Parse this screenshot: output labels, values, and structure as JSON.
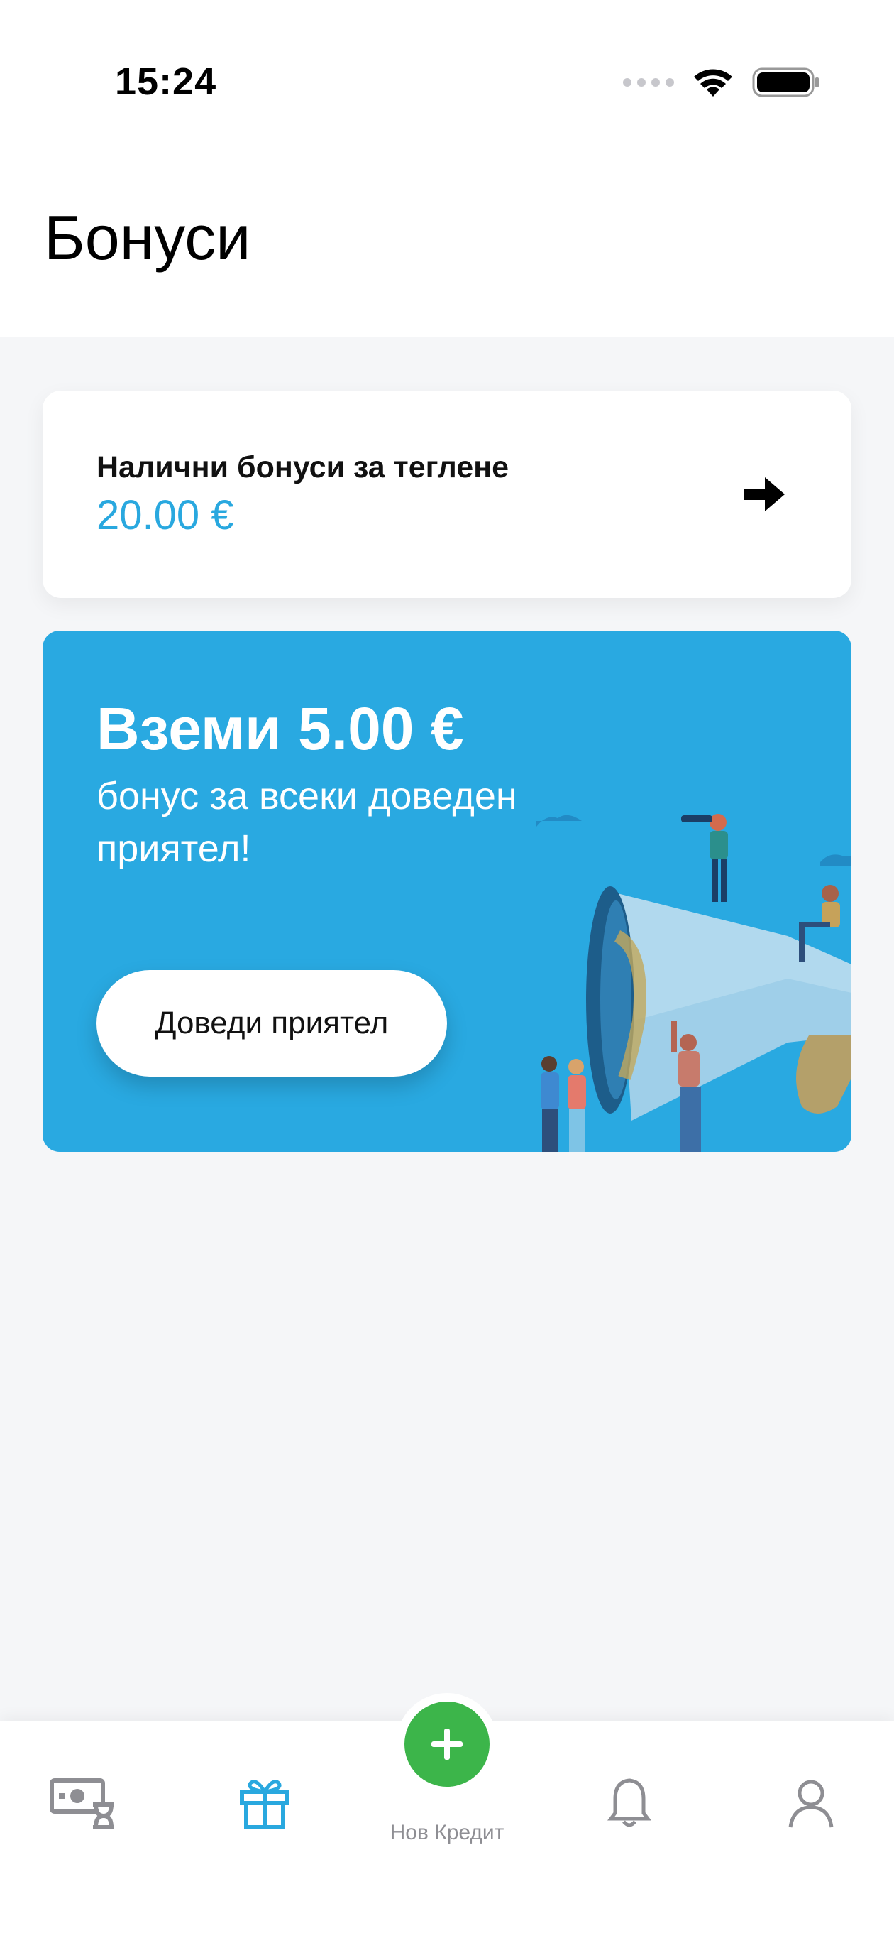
{
  "status_bar": {
    "time": "15:24"
  },
  "header": {
    "title": "Бонуси"
  },
  "bonus_card": {
    "label": "Налични бонуси за теглене",
    "amount": "20.00 €"
  },
  "promo": {
    "title": "Вземи 5.00 €",
    "subtitle": "бонус за всеки доведен приятел!",
    "button_label": "Доведи приятел"
  },
  "tab_bar": {
    "items": [
      {
        "icon": "loans-icon",
        "active": false
      },
      {
        "icon": "gift-icon",
        "active": true
      },
      {
        "icon": "plus-icon",
        "label": "Нов Кредит"
      },
      {
        "icon": "bell-icon",
        "active": false
      },
      {
        "icon": "profile-icon",
        "active": false
      }
    ],
    "active_color": "#29a8df",
    "inactive_color": "#8e8e93",
    "fab_color": "#3cb54a"
  },
  "colors": {
    "accent": "#29a8df",
    "promo_bg": "#29a9e1"
  }
}
